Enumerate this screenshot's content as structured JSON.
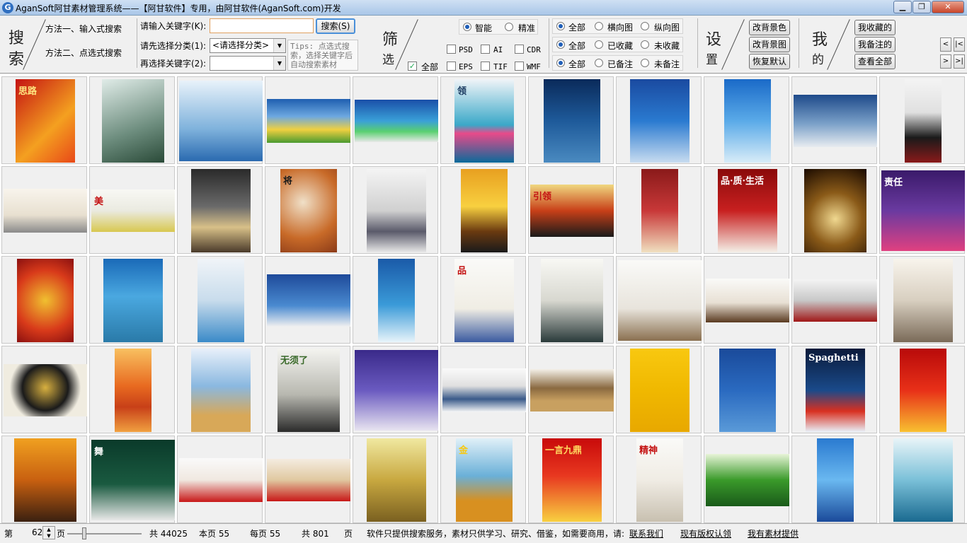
{
  "window": {
    "icon_letter": "G",
    "title": "AganSoft阿甘素材管理系统——【阿甘软件】专用，由阿甘软件(AganSoft.com)开发",
    "minimize": "▁",
    "maximize": "❐",
    "close": "✕"
  },
  "search": {
    "big_char_1": "搜",
    "big_char_2": "索",
    "method_1": "方法一、输入式搜索",
    "method_2": "方法二、点选式搜索",
    "keyword_label": "请输入关键字(K):",
    "keyword_value": "",
    "search_button": "搜索(S)",
    "category_label": "请先选择分类(1):",
    "category_value": "<请选择分类>",
    "subkey_label": "再选择关键字(2):",
    "subkey_value": "",
    "tips": "Tips: 点选式搜索，选择关键字后自动搜索素材"
  },
  "filter": {
    "big_char_1": "筛",
    "big_char_2": "选",
    "mode_smart": "智能",
    "mode_exact": "精准",
    "all_label": "全部",
    "formats": [
      "PSD",
      "AI",
      "CDR",
      "EPS",
      "TIF",
      "WMF"
    ],
    "orientation": [
      "全部",
      "横向图",
      "纵向图"
    ],
    "favorite": [
      "全部",
      "已收藏",
      "未收藏"
    ],
    "note": [
      "全部",
      "已备注",
      "未备注"
    ]
  },
  "settings": {
    "big_char_1": "设",
    "big_char_2": "置",
    "buttons": [
      "改背景色",
      "改背景图",
      "恢复默认"
    ]
  },
  "mine": {
    "big_char_1": "我",
    "big_char_2": "的",
    "buttons": [
      "我收藏的",
      "我备注的",
      "查看全部"
    ]
  },
  "nav": {
    "prev": "<",
    "first": "|<",
    "next": ">",
    "last": ">|"
  },
  "status": {
    "page_prefix": "第",
    "page_value": "62",
    "page_suffix": "页",
    "total": "共 44025",
    "this_page": "本页 55",
    "per_page": "每页 55",
    "total_pages": "共 801",
    "pages_unit": "页",
    "notice": "软件只提供搜索服务，素材只供学习、研究、借鉴，如需要商用，请:",
    "contact": "联系我们",
    "copyright": "现有版权认领",
    "provide": "我有素材提供"
  },
  "thumbnails": [
    {
      "label": "思路",
      "bg": "linear-gradient(135deg,#c41212,#f4a020 60%,#e84818)",
      "fg": "#ffe680"
    },
    {
      "label": "",
      "bg": "linear-gradient(160deg,#e0ece8,#6d8d7e 60%,#2a4a38)",
      "fg": "#ffffff"
    },
    {
      "label": "",
      "bg": "linear-gradient(180deg,#e8f2fa,#7fb2dc 60%,#2a6ab0)",
      "fg": "#1a4a80"
    },
    {
      "label": "",
      "bg": "linear-gradient(180deg,#1f5fb0,#6da8e0 40%,#f0d040 70%,#4a9a30)",
      "fg": "#ffffff"
    },
    {
      "label": "",
      "bg": "linear-gradient(180deg,#1a4fa8,#3aa0d8 50%,#5ad070 75%,#e8e8e8)",
      "fg": "#ffffff"
    },
    {
      "label": "领",
      "bg": "linear-gradient(180deg,#f0f4f8,#3aa8c8 55%,#e84a8a 65%,#0a6a9a)",
      "fg": "#1a3a60"
    },
    {
      "label": "",
      "bg": "linear-gradient(180deg,#0a2a5a,#1e5a9a 50%,#4a8ac0)",
      "fg": "#ffffff"
    },
    {
      "label": "",
      "bg": "linear-gradient(180deg,#1a4aa0,#2a7ad0 50%,#c8dcf0)",
      "fg": "#ffffff"
    },
    {
      "label": "",
      "bg": "linear-gradient(180deg,#1a6ac8,#5aaae8 50%,#d8ecf8)",
      "fg": "#ffffff"
    },
    {
      "label": "",
      "bg": "linear-gradient(180deg,#1e4a8a,#7aa0c8 55%,#e8ecf0)",
      "fg": "#ffffff"
    },
    {
      "label": "",
      "bg": "linear-gradient(180deg,#f4f4f4,#e0e0e0 40%,#1a1a1a 70%,#8a1a1a)",
      "fg": "#c41212"
    },
    {
      "label": "",
      "bg": "linear-gradient(180deg,#f8f4ec,#e8e0d0 60%,#8a8a8a)",
      "fg": "#c41212"
    },
    {
      "label": "美",
      "bg": "linear-gradient(180deg,#f8f8f4,#eaeae0 50%,#d8c850)",
      "fg": "#c41212"
    },
    {
      "label": "",
      "bg": "linear-gradient(180deg,#2a2a2a,#6a6a6a 45%,#d8c088 70%,#4a3a2a)",
      "fg": "#ffffff"
    },
    {
      "label": "将",
      "bg": "radial-gradient(circle at 40% 40%,#f0e0c8,#c86a28 60%,#8a3a18)",
      "fg": "#1a1a1a"
    },
    {
      "label": "",
      "bg": "linear-gradient(180deg,#f4f4f4,#d0d0d0 50%,#5a5a6a 75%,#e8e8e8)",
      "fg": "#333333"
    },
    {
      "label": "",
      "bg": "linear-gradient(180deg,#e8a020,#f8d040 45%,#6a3a10 75%,#1a1a1a)",
      "fg": "#ffffff"
    },
    {
      "label": "引领",
      "bg": "linear-gradient(180deg,#f0d880,#c84018 50%,#1a1a1a)",
      "fg": "#c41212"
    },
    {
      "label": "",
      "bg": "linear-gradient(180deg,#8a1a1a,#c83838 50%,#f0e0c0)",
      "fg": "#ffffff"
    },
    {
      "label": "品·质·生活",
      "bg": "linear-gradient(180deg,#8a0a0a,#c82020 50%,#f4f0e8)",
      "fg": "#ffffff"
    },
    {
      "label": "",
      "bg": "radial-gradient(circle at 50% 60%,#f0d890,#8a5a18 45%,#1a0a00)",
      "fg": "#ffffff"
    },
    {
      "label": "责任",
      "bg": "linear-gradient(180deg,#3a1a6a,#6a3aa0 50%,#e04080)",
      "fg": "#ffffff"
    },
    {
      "label": "",
      "bg": "radial-gradient(circle at 50% 50%,#f0c030,#d83a1a 60%,#8a1010)",
      "fg": "#ffffff"
    },
    {
      "label": "",
      "bg": "linear-gradient(180deg,#1a6ab8,#4aa8e0 45%,#2a7aa8)",
      "fg": "#ffffff"
    },
    {
      "label": "",
      "bg": "linear-gradient(180deg,#f0f4f8,#c8dcec 50%,#3a8ac8)",
      "fg": "#1a4a80"
    },
    {
      "label": "",
      "bg": "linear-gradient(180deg,#1e4a9a,#4a8ad0 60%,#f0f0f0)",
      "fg": "#ffffff"
    },
    {
      "label": "",
      "bg": "linear-gradient(180deg,#1a5aa8,#3a9ad8 55%,#e8f4fa)",
      "fg": "#ffffff"
    },
    {
      "label": "品",
      "bg": "linear-gradient(180deg,#fafaf8,#f0ede4 60%,#3a5aa0)",
      "fg": "#c41212"
    },
    {
      "label": "",
      "bg": "linear-gradient(180deg,#f8f8f4,#d8d8d0 50%,#2a3a3a)",
      "fg": "#1a1a1a"
    },
    {
      "label": "",
      "bg": "linear-gradient(180deg,#fafaf8,#e8e4dc 60%,#8a7050)",
      "fg": "#1a1a1a"
    },
    {
      "label": "",
      "bg": "linear-gradient(180deg,#fafaf8,#e8e0d4 55%,#5a3a20)",
      "fg": "#1a1a1a"
    },
    {
      "label": "",
      "bg": "linear-gradient(180deg,#f4f4f4,#c8c8c8 50%,#a01818)",
      "fg": "#c41212"
    },
    {
      "label": "",
      "bg": "linear-gradient(180deg,#f8f4ec,#d8cfc0 50%,#7a6a58)",
      "fg": "#333333"
    },
    {
      "label": "",
      "bg": "radial-gradient(circle at 50% 45%,#d8b040,#1a1a1a 45%,#f0ece0 70%)",
      "fg": "#333333"
    },
    {
      "label": "",
      "bg": "linear-gradient(180deg,#f8c060,#e86a20 45%,#c84018 70%,#f0a040)",
      "fg": "#ffffff"
    },
    {
      "label": "",
      "bg": "linear-gradient(180deg,#e8f0fa,#8ab8e0 45%,#d8a858 80%)",
      "fg": "#1a4a80"
    },
    {
      "label": "无须了",
      "bg": "linear-gradient(180deg,#f4f4f0,#b8b8b0 55%,#2a2a2a)",
      "fg": "#3a6a2a"
    },
    {
      "label": "",
      "bg": "linear-gradient(180deg,#3a2a8a,#6a5ac0 50%,#e8e4f0)",
      "fg": "#ffffff"
    },
    {
      "label": "",
      "bg": "linear-gradient(180deg,#fafafa,#e0e0e0 40%,#3a5a8a 70%,#f8f8f8)",
      "fg": "#1a1a1a"
    },
    {
      "label": "",
      "bg": "linear-gradient(180deg,#f4f0e8,#8a6a40 45%,#c8a060 75%)",
      "fg": "#1a1a1a"
    },
    {
      "label": "",
      "bg": "linear-gradient(180deg,#f8c810,#f0b800 50%,#e8a800)",
      "fg": "#1a1a1a"
    },
    {
      "label": "",
      "bg": "linear-gradient(180deg,#1a4a9a,#2a6ac0 50%,#5a9ad8)",
      "fg": "#ffffff"
    },
    {
      "label": "Spaghetti",
      "bg": "linear-gradient(180deg,#0a1a3a,#1a4a8a 50%,#d83020 75%,#e8f0f8)",
      "fg": "#ffffff"
    },
    {
      "label": "",
      "bg": "linear-gradient(180deg,#b80a0a,#e83018 50%,#f8c030)",
      "fg": "#ffd860"
    },
    {
      "label": "",
      "bg": "linear-gradient(180deg,#f0a020,#c86010 50%,#3a2010)",
      "fg": "#ffffff"
    },
    {
      "label": "舞",
      "bg": "linear-gradient(180deg,#0a3a2a,#1a5a40 55%,#e8e8e8)",
      "fg": "#ffffff"
    },
    {
      "label": "",
      "bg": "linear-gradient(180deg,#fafafa,#f0e8e0 50%,#c81818)",
      "fg": "#c41212"
    },
    {
      "label": "",
      "bg": "linear-gradient(180deg,#f4ece0,#e0c8a0 50%,#c81818)",
      "fg": "#1a1a1a"
    },
    {
      "label": "",
      "bg": "linear-gradient(180deg,#f0e8a0,#c8a840 50%,#7a6020)",
      "fg": "#1a1a1a"
    },
    {
      "label": "金",
      "bg": "linear-gradient(180deg,#e0f0f8,#6ab0d8 45%,#d89020 75%)",
      "fg": "#f8c810"
    },
    {
      "label": "一言九鼎",
      "bg": "linear-gradient(180deg,#c80a0a,#e83820 45%,#f8d040)",
      "fg": "#ffd860"
    },
    {
      "label": "精神",
      "bg": "linear-gradient(180deg,#fafaf8,#f0ece4 50%,#c8c0b0)",
      "fg": "#c41212"
    },
    {
      "label": "",
      "bg": "linear-gradient(180deg,#e8f4d8,#3a9a2a 50%,#1a5a1a)",
      "fg": "#ffffff"
    },
    {
      "label": "",
      "bg": "linear-gradient(180deg,#2a7ad0,#6ab8f0 50%,#1a4a9a)",
      "fg": "#ffffff"
    },
    {
      "label": "",
      "bg": "linear-gradient(180deg,#e8f4f8,#7ac0d8 50%,#1a6a90)",
      "fg": "#1a4a80"
    }
  ]
}
